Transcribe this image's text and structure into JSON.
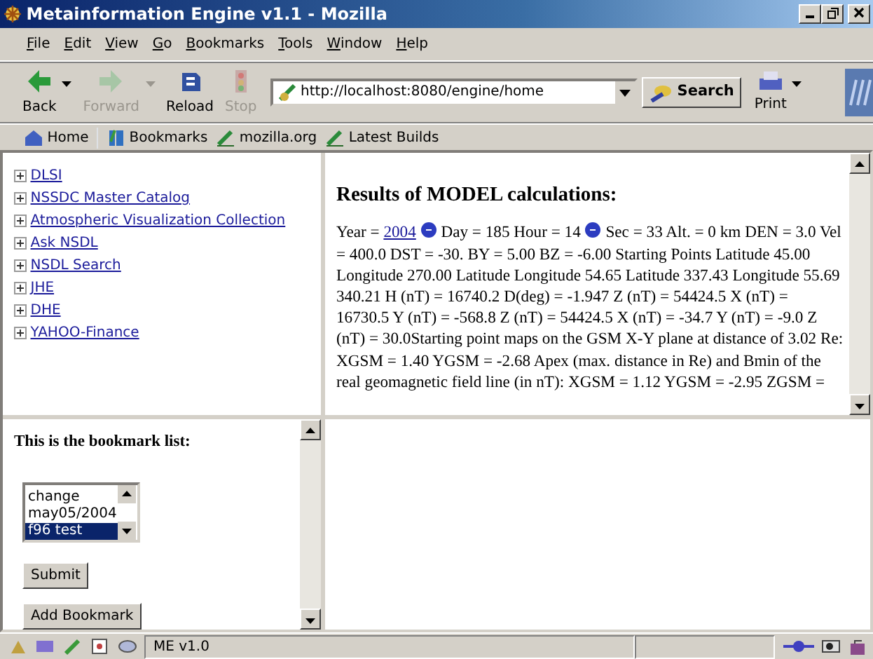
{
  "window": {
    "title": "Metainformation Engine v1.1 - Mozilla"
  },
  "menu": [
    "File",
    "Edit",
    "View",
    "Go",
    "Bookmarks",
    "Tools",
    "Window",
    "Help"
  ],
  "toolbar": {
    "buttons": [
      {
        "kind": "back",
        "label": "Back",
        "disabled": false,
        "dropdown": true
      },
      {
        "kind": "forward",
        "label": "Forward",
        "disabled": true,
        "dropdown": true
      },
      {
        "kind": "reload",
        "label": "Reload",
        "disabled": false,
        "dropdown": false
      },
      {
        "kind": "stop",
        "label": "Stop",
        "disabled": true,
        "dropdown": false
      }
    ],
    "address": "http://localhost:8080/engine/home",
    "search": "Search",
    "print": "Print"
  },
  "personal_toolbar": [
    {
      "kind": "home",
      "label": "Home"
    },
    {
      "kind": "bookmarks",
      "label": "Bookmarks"
    },
    {
      "kind": "link",
      "label": "mozilla.org"
    },
    {
      "kind": "link",
      "label": "Latest Builds"
    }
  ],
  "nav_tree": [
    "DLSI",
    "NSSDC Master Catalog",
    "Atmospheric Visualization Collection",
    "Ask NSDL",
    "NSDL Search",
    "JHE",
    "DHE",
    "YAHOO-Finance"
  ],
  "results": {
    "heading": "Results of MODEL calculations:",
    "year_label": "Year =",
    "year_link": "2004",
    "day_text": "Day = 185 Hour = 14",
    "rest": "Sec = 33 Alt. = 0 km DEN = 3.0 Vel = 400.0 DST = -30. BY = 5.00 BZ = -6.00 Starting Points Latitude 45.00 Longitude 270.00 Latitude Longitude 54.65 Latitude 337.43 Longitude 55.69 340.21 H (nT) = 16740.2 D(deg) = -1.947 Z (nT) = 54424.5 X (nT) = 16730.5 Y (nT) = -568.8 Z (nT) = 54424.5 X (nT) = -34.7 Y (nT) = -9.0 Z (nT) = 30.0Starting point maps on the GSM X-Y plane at distance of 3.02 Re: XGSM = 1.40 YGSM = -2.68 Apex (max. distance in Re) and Bmin of the real geomagnetic field line (in nT): XGSM = 1.12 YGSM = -2.95 ZGSM ="
  },
  "bookmarks": {
    "heading": "This is the bookmark list:",
    "items": [
      {
        "label": "change",
        "selected": false
      },
      {
        "label": "may05/2004",
        "selected": false
      },
      {
        "label": "f96 test",
        "selected": true
      }
    ],
    "buttons": [
      "Submit",
      "Add Bookmark"
    ]
  },
  "status_bar": {
    "text": "ME v1.0"
  }
}
